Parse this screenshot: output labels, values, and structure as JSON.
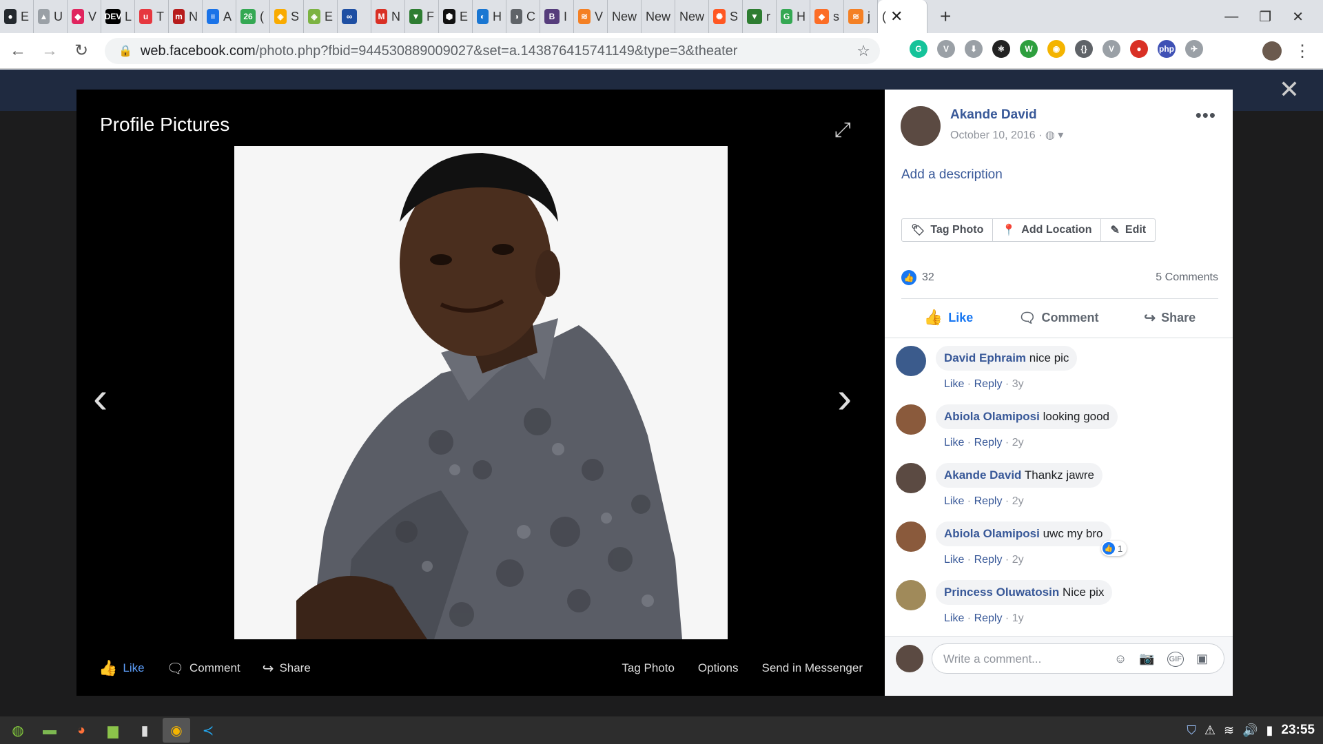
{
  "browser": {
    "tabs": [
      {
        "short": "E",
        "color": "#24292e",
        "glyph": "●"
      },
      {
        "short": "U",
        "color": "#9aa0a6",
        "glyph": "▲"
      },
      {
        "short": "V",
        "color": "#e0245e",
        "glyph": "◆"
      },
      {
        "short": "L",
        "color": "#000000",
        "glyph": "DEV"
      },
      {
        "short": "T",
        "color": "#e6373f",
        "glyph": "u"
      },
      {
        "short": "N",
        "color": "#b71c1c",
        "glyph": "m"
      },
      {
        "short": "A",
        "color": "#1a73e8",
        "glyph": "≡"
      },
      {
        "short": "(",
        "color": "#34a853",
        "glyph": "26"
      },
      {
        "short": "S",
        "color": "#f9ab00",
        "glyph": "◈"
      },
      {
        "short": "E",
        "color": "#7cb342",
        "glyph": "◈"
      },
      {
        "short": "",
        "color": "#1e4fa3",
        "glyph": "∞"
      },
      {
        "short": "N",
        "color": "#d93025",
        "glyph": "M"
      },
      {
        "short": "F",
        "color": "#2e7d32",
        "glyph": "▼"
      },
      {
        "short": "E",
        "color": "#111111",
        "glyph": "⬢"
      },
      {
        "short": "H",
        "color": "#1976d2",
        "glyph": "◐"
      },
      {
        "short": "C",
        "color": "#5f6368",
        "glyph": "◑"
      },
      {
        "short": "I",
        "color": "#563d7c",
        "glyph": "B"
      },
      {
        "short": "V",
        "color": "#f48024",
        "glyph": "≋"
      },
      {
        "short": "New",
        "color": "",
        "glyph": ""
      },
      {
        "short": "New",
        "color": "",
        "glyph": ""
      },
      {
        "short": "New",
        "color": "",
        "glyph": ""
      },
      {
        "short": "S",
        "color": "#ff5722",
        "glyph": "✺"
      },
      {
        "short": "r",
        "color": "#2e7d32",
        "glyph": "▼"
      },
      {
        "short": "H",
        "color": "#34a853",
        "glyph": "G"
      },
      {
        "short": "s",
        "color": "#fc6d26",
        "glyph": "◆"
      },
      {
        "short": "j",
        "color": "#f48024",
        "glyph": "≋"
      },
      {
        "short": "(",
        "color": "",
        "glyph": ""
      }
    ],
    "url_host": "web.facebook.com",
    "url_path": "/photo.php?fbid=944530889009027&set=a.143876415741149&type=3&theater",
    "extensions": [
      {
        "color": "#15c39a",
        "glyph": "G"
      },
      {
        "color": "#9aa0a6",
        "glyph": "V"
      },
      {
        "color": "#9aa0a6",
        "glyph": "⬇"
      },
      {
        "color": "#222222",
        "glyph": "⚛"
      },
      {
        "color": "#2e9f3e",
        "glyph": "W"
      },
      {
        "color": "#f4b400",
        "glyph": "◉"
      },
      {
        "color": "#5f6368",
        "glyph": "{}"
      },
      {
        "color": "#9aa0a6",
        "glyph": "V"
      },
      {
        "color": "#d93025",
        "glyph": "●"
      },
      {
        "color": "#3f51b5",
        "glyph": "php"
      },
      {
        "color": "#9aa0a6",
        "glyph": "✈"
      }
    ]
  },
  "theater": {
    "title": "Profile Pictures",
    "actions": {
      "like": "Like",
      "comment": "Comment",
      "share": "Share"
    },
    "right_actions": {
      "tag": "Tag Photo",
      "options": "Options",
      "messenger": "Send in Messenger"
    }
  },
  "panel": {
    "author": "Akande David",
    "date": "October 10, 2016 ·",
    "add_description": "Add a description",
    "tag_buttons": {
      "tag": "Tag Photo",
      "location": "Add Location",
      "edit": "Edit"
    },
    "like_count": "32",
    "comment_count": "5 Comments",
    "actions": {
      "like": "Like",
      "comment": "Comment",
      "share": "Share"
    },
    "comments": [
      {
        "name": "David Ephraim",
        "text": "nice pic",
        "meta_like": "Like",
        "meta_reply": "Reply",
        "age": "3y",
        "avatar": "#3b5b8c"
      },
      {
        "name": "Abiola Olamiposi",
        "text": "looking good",
        "meta_like": "Like",
        "meta_reply": "Reply",
        "age": "2y",
        "avatar": "#8a5a3c"
      },
      {
        "name": "Akande David",
        "text": "Thankz jawre",
        "meta_like": "Like",
        "meta_reply": "Reply",
        "age": "2y",
        "avatar": "#5b4a42"
      },
      {
        "name": "Abiola Olamiposi",
        "text": "uwc my bro",
        "meta_like": "Like",
        "meta_reply": "Reply",
        "age": "2y",
        "avatar": "#8a5a3c",
        "reaction_count": "1"
      },
      {
        "name": "Princess Oluwatosin",
        "text": "Nice pix",
        "meta_like": "Like",
        "meta_reply": "Reply",
        "age": "1y",
        "avatar": "#a08a5a"
      }
    ],
    "write_placeholder": "Write a comment..."
  },
  "taskbar": {
    "clock": "23:55"
  }
}
